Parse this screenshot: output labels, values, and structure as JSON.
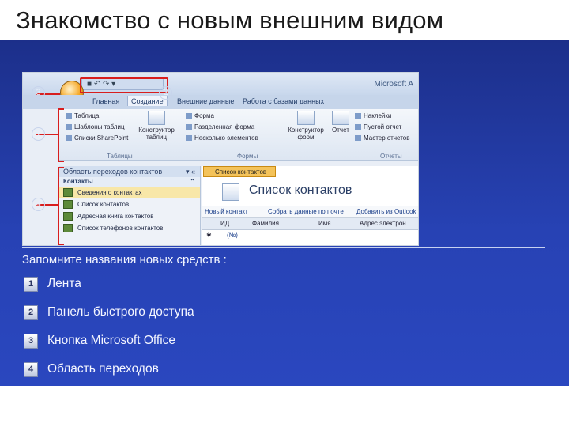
{
  "slide": {
    "title": "Знакомство с новым внешним видом"
  },
  "screenshot": {
    "app_title": "Microsoft A",
    "qat_icons": [
      "save-icon",
      "undo-icon",
      "redo-icon"
    ],
    "tabs": [
      "Главная",
      "Создание",
      "Внешние данные",
      "Работа с базами данных"
    ],
    "active_tab": "Создание",
    "ribbon": {
      "table_items": [
        "Таблица",
        "Шаблоны таблиц",
        "Списки SharePoint"
      ],
      "constructor_tables": "Конструктор таблиц",
      "forms_items": [
        "Форма",
        "Разделенная форма",
        "Несколько элементов"
      ],
      "constructor_forms": "Конструктор форм",
      "report": "Отчет",
      "report_items": [
        "Наклейки",
        "Пустой отчет",
        "Мастер отчетов"
      ],
      "groups": [
        "Таблицы",
        "Формы",
        "Отчеты"
      ]
    },
    "nav_pane": {
      "header": "Область переходов контактов",
      "group": "Контакты",
      "items": [
        "Сведения о контактах",
        "Список контактов",
        "Адресная книга контактов",
        "Список телефонов контактов"
      ],
      "selected_index": 0
    },
    "document": {
      "tab": "Список контактов",
      "title": "Список контактов",
      "links": [
        "Новый контакт",
        "Собрать данные по почте",
        "Добавить из Outlook"
      ],
      "columns": [
        "ИД",
        "Фамилия",
        "Имя",
        "Адрес электрон"
      ],
      "new_row": "(№)"
    },
    "callouts": [
      "3",
      "2",
      "1",
      "4"
    ]
  },
  "legend": {
    "intro": "Запомните названия новых средств :",
    "items": [
      {
        "num": "1",
        "label": "Лента"
      },
      {
        "num": "2",
        "label": "Панель быстрого доступа"
      },
      {
        "num": "3",
        "label": "Кнопка Microsoft Office"
      },
      {
        "num": "4",
        "label": "Область переходов"
      }
    ]
  },
  "colors": {
    "panel_top": "#1c2f8a",
    "panel_bottom": "#2a47bf",
    "callout_red": "#d81e1e",
    "office_orange": "#f5a623"
  }
}
